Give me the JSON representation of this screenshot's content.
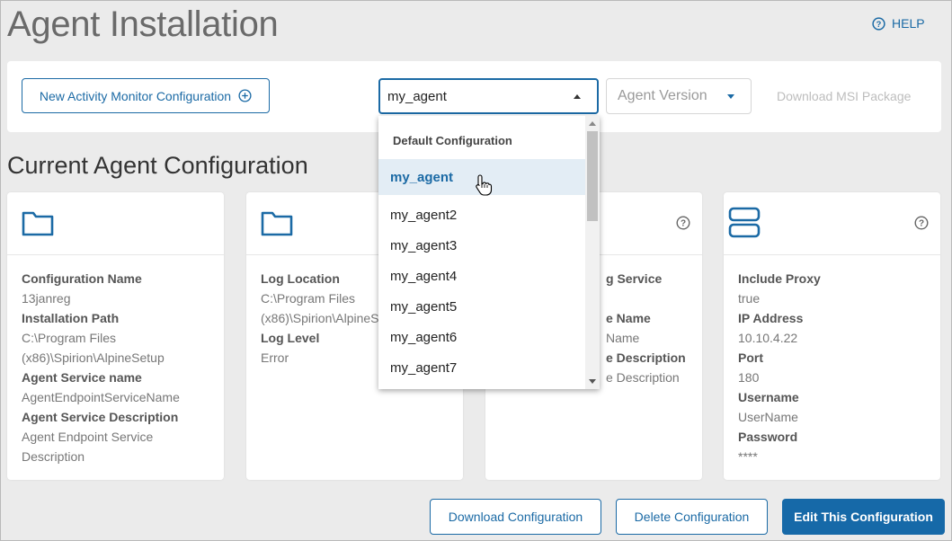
{
  "header": {
    "title": "Agent Installation",
    "help_label": "HELP"
  },
  "toolbar": {
    "new_config_label": "New Activity Monitor Configuration",
    "agent_select_value": "my_agent",
    "agent_version_placeholder": "Agent  Version",
    "download_msi_label": "Download MSI Package"
  },
  "section_title": "Current Agent Configuration",
  "cards": [
    {
      "fields": [
        {
          "label": "Configuration Name",
          "value": "13janreg"
        },
        {
          "label": "Installation Path",
          "value": "C:\\Program Files (x86)\\Spirion\\AlpineSetup"
        },
        {
          "label": "Agent Service name",
          "value": "AgentEndpointServiceName"
        },
        {
          "label": "Agent Service Description",
          "value": "Agent Endpoint Service Description"
        }
      ]
    },
    {
      "fields": [
        {
          "label": "Log Location",
          "value": "C:\\Program Files (x86)\\Spirion\\AlpineS"
        },
        {
          "label": "Log Level",
          "value": "Error"
        }
      ]
    },
    {
      "fields": [
        {
          "label": "g Service",
          "value": ""
        },
        {
          "label": "e Name",
          "value": "Name"
        },
        {
          "label": "e Description",
          "value": "e Description"
        }
      ]
    },
    {
      "fields": [
        {
          "label": "Include Proxy",
          "value": "true"
        },
        {
          "label": "IP Address",
          "value": "10.10.4.22"
        },
        {
          "label": "Port",
          "value": "180"
        },
        {
          "label": "Username",
          "value": "UserName"
        },
        {
          "label": "Password",
          "value": "****"
        }
      ]
    }
  ],
  "dropdown": {
    "header": "Default Configuration",
    "selected": "my_agent",
    "options": [
      "my_agent",
      "my_agent2",
      "my_agent3",
      "my_agent4",
      "my_agent5",
      "my_agent6",
      "my_agent7"
    ]
  },
  "footer": {
    "download_config_label": "Download Configuration",
    "delete_config_label": "Delete Configuration",
    "edit_config_label": "Edit This Configuration"
  },
  "colors": {
    "accent": "#1b6aa5",
    "primary_button": "#1669a8",
    "background": "#ebebeb"
  },
  "icons": [
    "help-circle-icon",
    "plus-circle-icon",
    "folder-icon",
    "server-icon",
    "question-icon",
    "hand-cursor-icon"
  ]
}
